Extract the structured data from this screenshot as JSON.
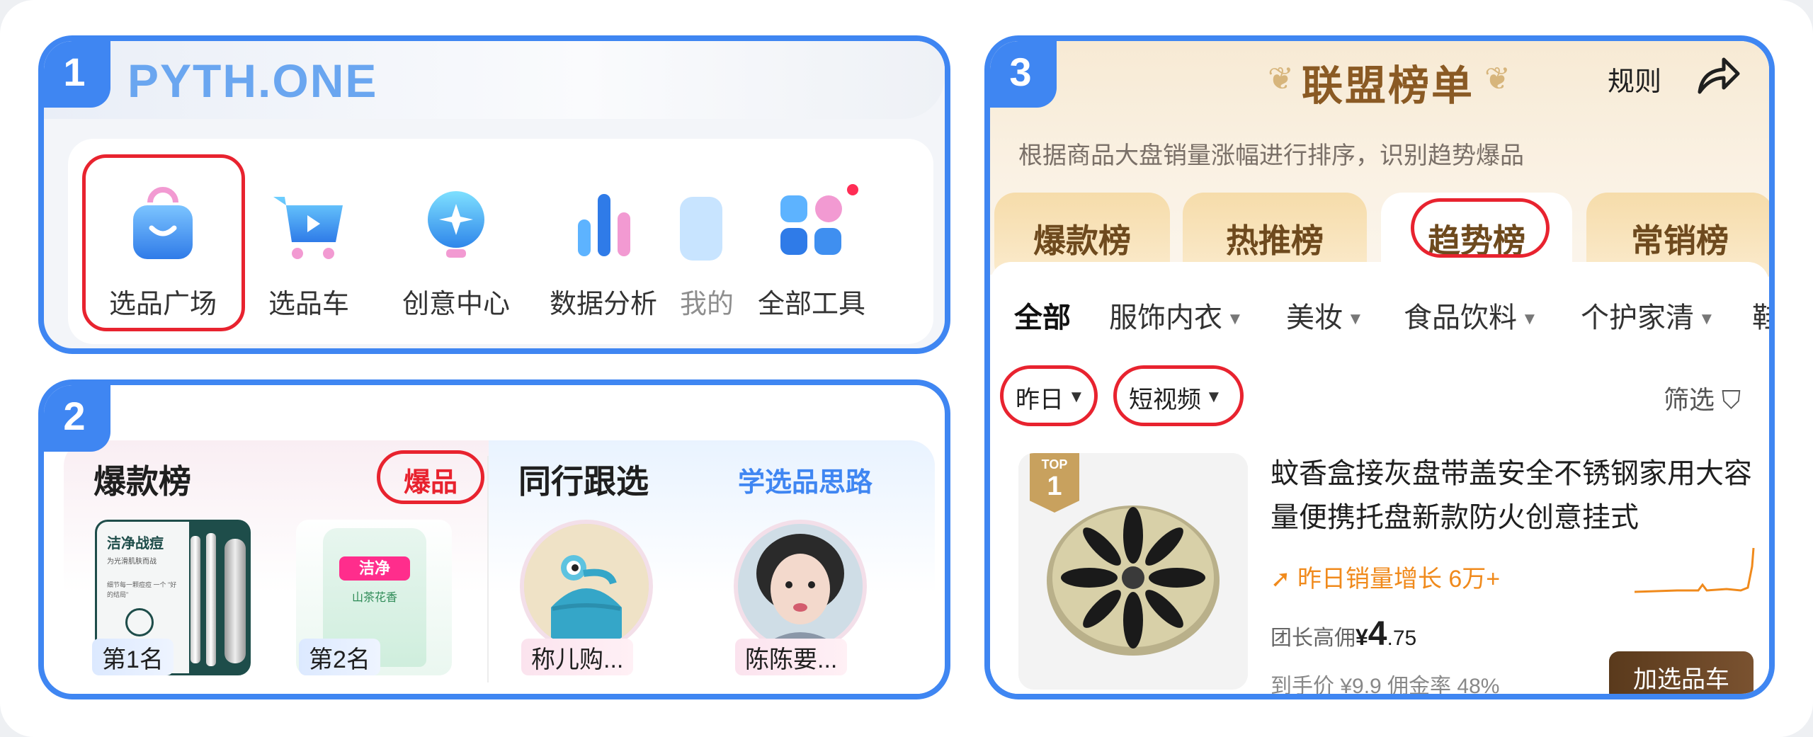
{
  "panel1": {
    "number": "1",
    "brand": "PYTH.ONE",
    "tools": [
      {
        "label": "选品广场",
        "icon": "shopping-bag-icon"
      },
      {
        "label": "选品车",
        "icon": "shopping-cart-icon"
      },
      {
        "label": "创意中心",
        "icon": "lightbulb-icon"
      },
      {
        "label": "数据分析",
        "icon": "bar-chart-icon"
      },
      {
        "label": "我的",
        "icon": "profile-icon"
      },
      {
        "label": "全部工具",
        "icon": "app-grid-icon"
      }
    ]
  },
  "panel2": {
    "number": "2",
    "left_title": "爆款榜",
    "left_tag": "爆品",
    "right_title": "同行跟选",
    "right_link": "学选品思路",
    "products": [
      {
        "rank": "第1名",
        "pkg_text": "洁净战痘",
        "pkg_sub": "为光滑肌肤而战",
        "pkg_note": "细节每一颗痘痘 一个 \"好的结局\""
      },
      {
        "rank": "第2名",
        "pkg_text": "洁净",
        "pkg_sub": "山茶花香"
      }
    ],
    "creators": [
      {
        "name": "称儿购..."
      },
      {
        "name": "陈陈要..."
      }
    ]
  },
  "panel3": {
    "number": "3",
    "title": "联盟榜单",
    "rule": "规则",
    "subtitle": "根据商品大盘销量涨幅进行排序，识别趋势爆品",
    "tabs": [
      "爆款榜",
      "热推榜",
      "趋势榜",
      "常销榜"
    ],
    "active_tab": "趋势榜",
    "categories": [
      "全部",
      "服饰内衣",
      "美妆",
      "食品饮料",
      "个护家清",
      "鞋"
    ],
    "chips": [
      "昨日",
      "短视频"
    ],
    "filter": "筛选",
    "product": {
      "badge_top": "TOP",
      "badge_rank": "1",
      "name": "蚊香盒接灰盘带盖安全不锈钢家用大容量便携托盘新款防火创意挂式",
      "growth": "昨日销量增长 6万+",
      "commission_label": "团长高佣",
      "currency": "¥",
      "price_int": "4",
      "price_dec": ".75",
      "meta": "到手价 ¥9.9   佣金率 48%",
      "add_button": "加选品车"
    }
  },
  "colors": {
    "frame_blue": "#3f86f2",
    "highlight_red": "#e8232f",
    "growth_orange": "#f08a1c",
    "gold_brown": "#8a5a24"
  }
}
